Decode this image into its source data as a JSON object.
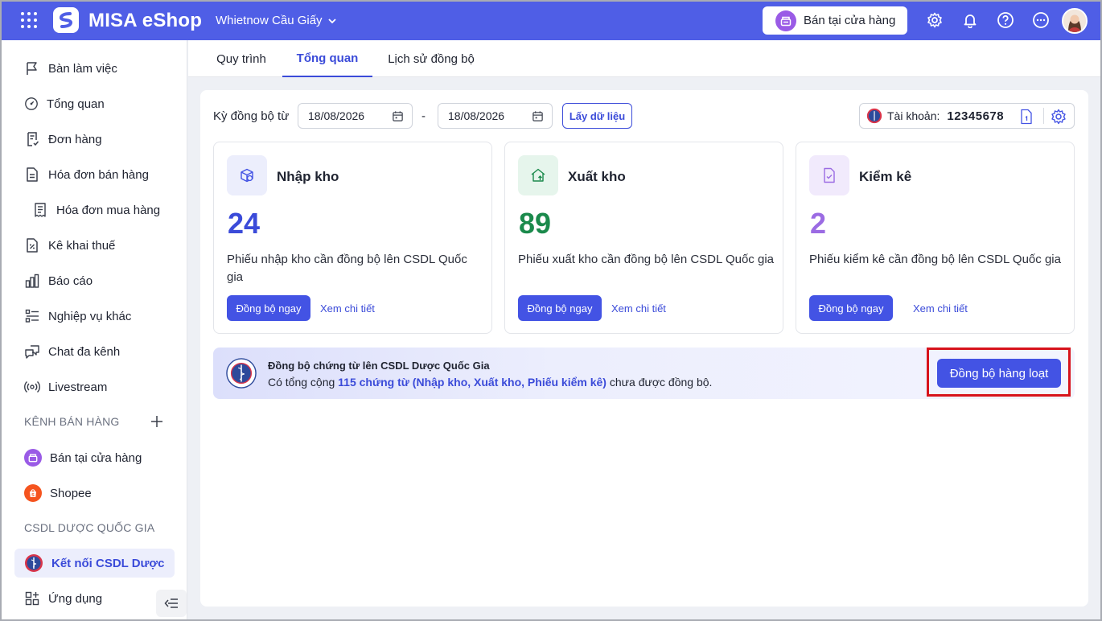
{
  "app": {
    "name": "MISA eShop",
    "branch": "Whietnow Cầu Giấy",
    "store_button": "Bán tại cửa hàng"
  },
  "colors": {
    "primary": "#4353e4",
    "topbar": "#4f5ee6",
    "import": "#3b4bd9",
    "export": "#1b8a4c",
    "inventory": "#9b6be3",
    "highlight": "#d7131c"
  },
  "sidebar": {
    "items": [
      {
        "label": "Bàn làm việc",
        "icon": "flag-icon"
      },
      {
        "label": "Tổng quan",
        "icon": "gauge-icon"
      },
      {
        "label": "Đơn hàng",
        "icon": "order-icon"
      },
      {
        "label": "Hóa đơn bán hàng",
        "icon": "invoice-icon"
      },
      {
        "label": "Hóa đơn mua hàng",
        "icon": "receipt-icon"
      },
      {
        "label": "Kê khai thuế",
        "icon": "tax-icon"
      },
      {
        "label": "Báo cáo",
        "icon": "chart-icon"
      },
      {
        "label": "Nghiệp vụ khác",
        "icon": "list-icon"
      },
      {
        "label": "Chat đa kênh",
        "icon": "chat-icon"
      },
      {
        "label": "Livestream",
        "icon": "broadcast-icon"
      }
    ],
    "section_channels": "KÊNH BÁN HÀNG",
    "channels": [
      {
        "label": "Bán tại cửa hàng"
      },
      {
        "label": "Shopee"
      }
    ],
    "section_pharma": "CSDL DƯỢC QUỐC GIA",
    "pharma_item": "Kết nối CSDL Dược",
    "apps_item": "Ứng dụng"
  },
  "tabs": [
    "Quy trình",
    "Tổng quan",
    "Lịch sử đồng bộ"
  ],
  "active_tab": "Tổng quan",
  "filter": {
    "label": "Kỳ đồng bộ từ",
    "from": "18/08/2026",
    "separator": "-",
    "to": "18/08/2026",
    "fetch_button": "Lấy dữ liệu"
  },
  "account": {
    "label": "Tài khoản:",
    "number": "12345678"
  },
  "cards": [
    {
      "title": "Nhập kho",
      "count": "24",
      "desc": "Phiếu nhập kho cần đồng bộ lên CSDL Quốc gia",
      "sync": "Đồng bộ ngay",
      "detail": "Xem chi tiết"
    },
    {
      "title": "Xuất kho",
      "count": "89",
      "desc": "Phiếu xuất kho cần đồng bộ lên CSDL Quốc gia",
      "sync": "Đồng bộ ngay",
      "detail": "Xem chi tiết"
    },
    {
      "title": "Kiểm kê",
      "count": "2",
      "desc": "Phiếu kiểm kê cần đồng bộ lên CSDL Quốc gia",
      "sync": "Đồng bộ ngay",
      "detail": "Xem chi tiết"
    }
  ],
  "banner": {
    "title": "Đồng bộ chứng từ lên CSDL Dược Quốc Gia",
    "text_before": "Có tổng cộng ",
    "text_highlight": "115 chứng từ (Nhập kho, Xuất kho, Phiếu kiểm kê)",
    "text_after": " chưa được đồng bộ.",
    "bulk_button": "Đồng bộ hàng loạt"
  }
}
